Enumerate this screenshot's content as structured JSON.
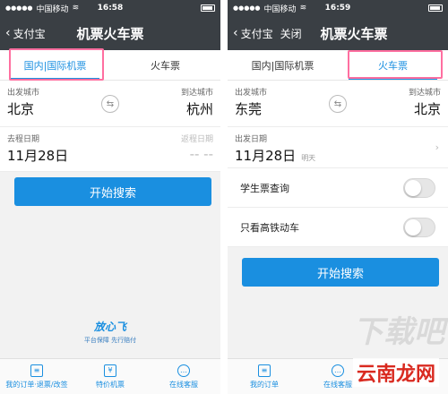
{
  "left": {
    "status": {
      "carrier": "中国移动",
      "time": "16:58"
    },
    "nav": {
      "back": "支付宝",
      "title": "机票火车票"
    },
    "tabs": [
      "国内|国际机票",
      "火车票"
    ],
    "from": {
      "label": "出发城市",
      "city": "北京"
    },
    "to": {
      "label": "到达城市",
      "city": "杭州"
    },
    "depart": {
      "label": "去程日期",
      "date": "11月28日"
    },
    "return": {
      "label": "返程日期",
      "date": "-- --"
    },
    "search": "开始搜索",
    "logo": {
      "title": "放心飞",
      "slogan": "平台保障 先行赔付"
    },
    "bottom": [
      "我的订单·退票/改签",
      "特价机票",
      "在线客服"
    ]
  },
  "right": {
    "status": {
      "carrier": "中国移动",
      "time": "16:59"
    },
    "nav": {
      "back": "支付宝",
      "close": "关闭",
      "title": "机票火车票"
    },
    "tabs": [
      "国内|国际机票",
      "火车票"
    ],
    "from": {
      "label": "出发城市",
      "city": "东莞"
    },
    "to": {
      "label": "到达城市",
      "city": "北京"
    },
    "depart": {
      "label": "出发日期",
      "date": "11月28日",
      "sub": "明天"
    },
    "student": "学生票查询",
    "highspeed": "只看高铁动车",
    "search": "开始搜索",
    "bottom": [
      "我的订单",
      "在线客服"
    ]
  },
  "watermark": {
    "text1": "下载吧",
    "text2": "云南龙网"
  },
  "colors": {
    "accent": "#1a8fe0",
    "header": "#3a3f44",
    "highlight": "#ff6fa0"
  }
}
